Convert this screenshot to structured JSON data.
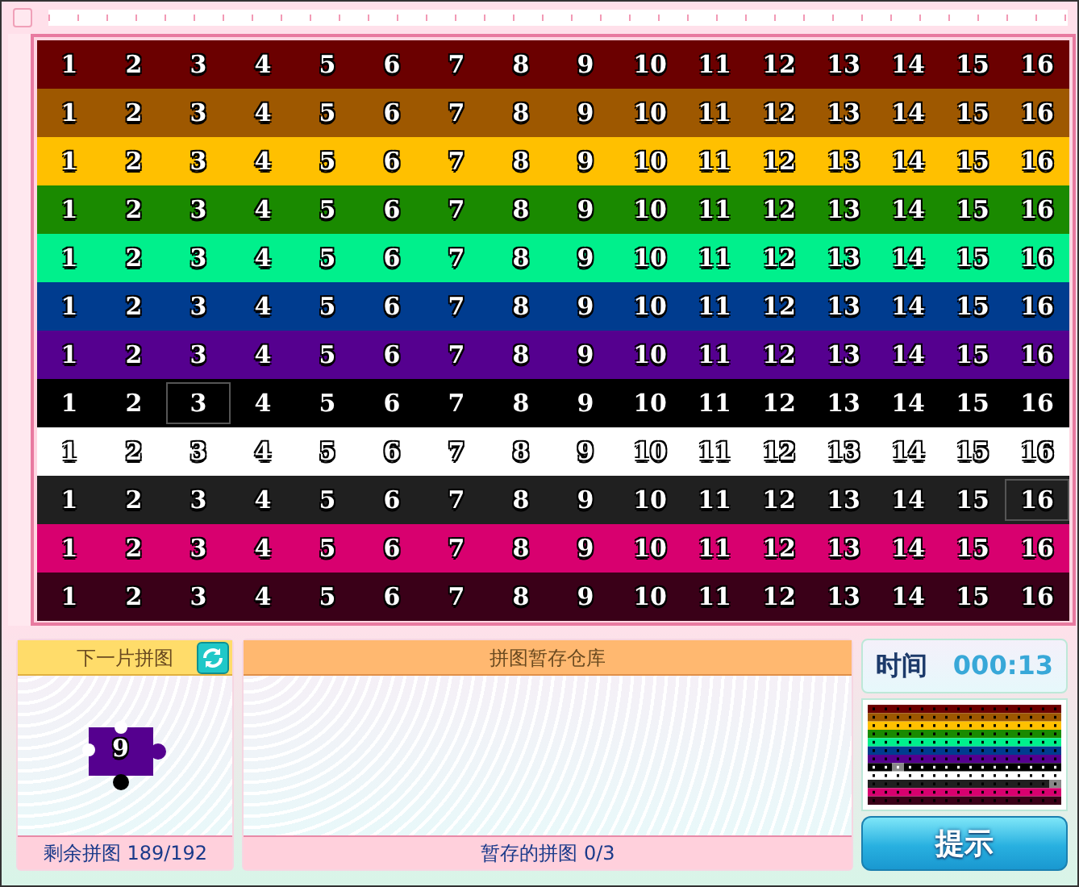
{
  "board": {
    "rows": [
      {
        "color": "#6b0000",
        "outlined": true,
        "cells": [
          {
            "n": "1",
            "placed": true
          },
          {
            "n": "2",
            "placed": true
          },
          {
            "n": "3",
            "placed": true
          },
          {
            "n": "4",
            "placed": true
          },
          {
            "n": "5",
            "placed": true
          },
          {
            "n": "6",
            "placed": true
          },
          {
            "n": "7",
            "placed": true
          },
          {
            "n": "8",
            "placed": true
          },
          {
            "n": "9",
            "placed": true
          },
          {
            "n": "10",
            "placed": true
          },
          {
            "n": "11",
            "placed": true
          },
          {
            "n": "12",
            "placed": true
          },
          {
            "n": "13",
            "placed": true
          },
          {
            "n": "14",
            "placed": true
          },
          {
            "n": "15",
            "placed": true
          },
          {
            "n": "16",
            "placed": true
          }
        ]
      },
      {
        "color": "#9e5800",
        "outlined": true,
        "cells": [
          {
            "n": "1",
            "placed": true
          },
          {
            "n": "2",
            "placed": true
          },
          {
            "n": "3",
            "placed": true
          },
          {
            "n": "4",
            "placed": true
          },
          {
            "n": "5",
            "placed": true
          },
          {
            "n": "6",
            "placed": true
          },
          {
            "n": "7",
            "placed": true
          },
          {
            "n": "8",
            "placed": true
          },
          {
            "n": "9",
            "placed": true
          },
          {
            "n": "10",
            "placed": true
          },
          {
            "n": "11",
            "placed": true
          },
          {
            "n": "12",
            "placed": true
          },
          {
            "n": "13",
            "placed": true
          },
          {
            "n": "14",
            "placed": true
          },
          {
            "n": "15",
            "placed": true
          },
          {
            "n": "16",
            "placed": true
          }
        ]
      },
      {
        "color": "#ffc000",
        "outlined": true,
        "cells": [
          {
            "n": "1",
            "placed": true
          },
          {
            "n": "2",
            "placed": true
          },
          {
            "n": "3",
            "placed": true
          },
          {
            "n": "4",
            "placed": true
          },
          {
            "n": "5",
            "placed": true
          },
          {
            "n": "6",
            "placed": true
          },
          {
            "n": "7",
            "placed": true
          },
          {
            "n": "8",
            "placed": true
          },
          {
            "n": "9",
            "placed": true
          },
          {
            "n": "10",
            "placed": true
          },
          {
            "n": "11",
            "placed": true
          },
          {
            "n": "12",
            "placed": true
          },
          {
            "n": "13",
            "placed": true
          },
          {
            "n": "14",
            "placed": true
          },
          {
            "n": "15",
            "placed": true
          },
          {
            "n": "16",
            "placed": true
          }
        ]
      },
      {
        "color": "#1a8a00",
        "outlined": true,
        "cells": [
          {
            "n": "1",
            "placed": true
          },
          {
            "n": "2",
            "placed": true
          },
          {
            "n": "3",
            "placed": true
          },
          {
            "n": "4",
            "placed": true
          },
          {
            "n": "5",
            "placed": true
          },
          {
            "n": "6",
            "placed": true
          },
          {
            "n": "7",
            "placed": true
          },
          {
            "n": "8",
            "placed": true
          },
          {
            "n": "9",
            "placed": true
          },
          {
            "n": "10",
            "placed": true
          },
          {
            "n": "11",
            "placed": true
          },
          {
            "n": "12",
            "placed": true
          },
          {
            "n": "13",
            "placed": true
          },
          {
            "n": "14",
            "placed": true
          },
          {
            "n": "15",
            "placed": true
          },
          {
            "n": "16",
            "placed": true
          }
        ]
      },
      {
        "color": "#00f08c",
        "outlined": true,
        "cells": [
          {
            "n": "1",
            "placed": true
          },
          {
            "n": "2",
            "placed": true
          },
          {
            "n": "3",
            "placed": true
          },
          {
            "n": "4",
            "placed": true
          },
          {
            "n": "5",
            "placed": true
          },
          {
            "n": "6",
            "placed": true
          },
          {
            "n": "7",
            "placed": true
          },
          {
            "n": "8",
            "placed": true
          },
          {
            "n": "9",
            "placed": true
          },
          {
            "n": "10",
            "placed": true
          },
          {
            "n": "11",
            "placed": true
          },
          {
            "n": "12",
            "placed": true
          },
          {
            "n": "13",
            "placed": true
          },
          {
            "n": "14",
            "placed": true
          },
          {
            "n": "15",
            "placed": true
          },
          {
            "n": "16",
            "placed": true
          }
        ]
      },
      {
        "color": "#003c8f",
        "outlined": true,
        "cells": [
          {
            "n": "1",
            "placed": true
          },
          {
            "n": "2",
            "placed": true
          },
          {
            "n": "3",
            "placed": true
          },
          {
            "n": "4",
            "placed": true
          },
          {
            "n": "5",
            "placed": true
          },
          {
            "n": "6",
            "placed": true
          },
          {
            "n": "7",
            "placed": true
          },
          {
            "n": "8",
            "placed": true
          },
          {
            "n": "9",
            "placed": true
          },
          {
            "n": "10",
            "placed": true
          },
          {
            "n": "11",
            "placed": true
          },
          {
            "n": "12",
            "placed": true
          },
          {
            "n": "13",
            "placed": true
          },
          {
            "n": "14",
            "placed": true
          },
          {
            "n": "15",
            "placed": true
          },
          {
            "n": "16",
            "placed": true
          }
        ]
      },
      {
        "color": "#55008f",
        "outlined": true,
        "cells": [
          {
            "n": "1",
            "placed": true
          },
          {
            "n": "2",
            "placed": true
          },
          {
            "n": "3",
            "placed": true
          },
          {
            "n": "4",
            "placed": true
          },
          {
            "n": "5",
            "placed": true
          },
          {
            "n": "6",
            "placed": true
          },
          {
            "n": "7",
            "placed": true
          },
          {
            "n": "8",
            "placed": true
          },
          {
            "n": "9",
            "placed": true
          },
          {
            "n": "10",
            "placed": true
          },
          {
            "n": "11",
            "placed": true
          },
          {
            "n": "12",
            "placed": true
          },
          {
            "n": "13",
            "placed": true
          },
          {
            "n": "14",
            "placed": true
          },
          {
            "n": "15",
            "placed": true
          },
          {
            "n": "16",
            "placed": true
          }
        ]
      },
      {
        "color": "#000000",
        "outlined": false,
        "cells": [
          {
            "n": "1",
            "placed": true
          },
          {
            "n": "2",
            "placed": true
          },
          {
            "n": "3",
            "placed": false
          },
          {
            "n": "4",
            "placed": true
          },
          {
            "n": "5",
            "placed": true
          },
          {
            "n": "6",
            "placed": true
          },
          {
            "n": "7",
            "placed": true
          },
          {
            "n": "8",
            "placed": true
          },
          {
            "n": "9",
            "placed": true
          },
          {
            "n": "10",
            "placed": true
          },
          {
            "n": "11",
            "placed": true
          },
          {
            "n": "12",
            "placed": true
          },
          {
            "n": "13",
            "placed": true
          },
          {
            "n": "14",
            "placed": true
          },
          {
            "n": "15",
            "placed": true
          },
          {
            "n": "16",
            "placed": true
          }
        ]
      },
      {
        "color": "#ffffff",
        "outlined": true,
        "cells": [
          {
            "n": "1",
            "placed": true
          },
          {
            "n": "2",
            "placed": true
          },
          {
            "n": "3",
            "placed": true
          },
          {
            "n": "4",
            "placed": true
          },
          {
            "n": "5",
            "placed": true
          },
          {
            "n": "6",
            "placed": true
          },
          {
            "n": "7",
            "placed": true
          },
          {
            "n": "8",
            "placed": true
          },
          {
            "n": "9",
            "placed": true
          },
          {
            "n": "10",
            "placed": true
          },
          {
            "n": "11",
            "placed": true
          },
          {
            "n": "12",
            "placed": true
          },
          {
            "n": "13",
            "placed": true
          },
          {
            "n": "14",
            "placed": true
          },
          {
            "n": "15",
            "placed": true
          },
          {
            "n": "16",
            "placed": true
          }
        ]
      },
      {
        "color": "#202020",
        "outlined": true,
        "cells": [
          {
            "n": "1",
            "placed": true
          },
          {
            "n": "2",
            "placed": true
          },
          {
            "n": "3",
            "placed": true
          },
          {
            "n": "4",
            "placed": true
          },
          {
            "n": "5",
            "placed": true
          },
          {
            "n": "6",
            "placed": true
          },
          {
            "n": "7",
            "placed": true
          },
          {
            "n": "8",
            "placed": true
          },
          {
            "n": "9",
            "placed": true
          },
          {
            "n": "10",
            "placed": true
          },
          {
            "n": "11",
            "placed": true
          },
          {
            "n": "12",
            "placed": true
          },
          {
            "n": "13",
            "placed": true
          },
          {
            "n": "14",
            "placed": true
          },
          {
            "n": "15",
            "placed": true
          },
          {
            "n": "16",
            "placed": false
          }
        ]
      },
      {
        "color": "#d8006f",
        "outlined": true,
        "cells": [
          {
            "n": "1",
            "placed": true
          },
          {
            "n": "2",
            "placed": true
          },
          {
            "n": "3",
            "placed": true
          },
          {
            "n": "4",
            "placed": true
          },
          {
            "n": "5",
            "placed": true
          },
          {
            "n": "6",
            "placed": true
          },
          {
            "n": "7",
            "placed": true
          },
          {
            "n": "8",
            "placed": true
          },
          {
            "n": "9",
            "placed": true
          },
          {
            "n": "10",
            "placed": true
          },
          {
            "n": "11",
            "placed": true
          },
          {
            "n": "12",
            "placed": true
          },
          {
            "n": "13",
            "placed": true
          },
          {
            "n": "14",
            "placed": true
          },
          {
            "n": "15",
            "placed": true
          },
          {
            "n": "16",
            "placed": true
          }
        ]
      },
      {
        "color": "#3a0018",
        "outlined": true,
        "cells": [
          {
            "n": "1",
            "placed": true
          },
          {
            "n": "2",
            "placed": true
          },
          {
            "n": "3",
            "placed": true
          },
          {
            "n": "4",
            "placed": true
          },
          {
            "n": "5",
            "placed": true
          },
          {
            "n": "6",
            "placed": true
          },
          {
            "n": "7",
            "placed": true
          },
          {
            "n": "8",
            "placed": true
          },
          {
            "n": "9",
            "placed": true
          },
          {
            "n": "10",
            "placed": true
          },
          {
            "n": "11",
            "placed": true
          },
          {
            "n": "12",
            "placed": true
          },
          {
            "n": "13",
            "placed": true
          },
          {
            "n": "14",
            "placed": true
          },
          {
            "n": "15",
            "placed": true
          },
          {
            "n": "16",
            "placed": true
          }
        ]
      }
    ]
  },
  "next_piece": {
    "title": "下一片拼图",
    "label": "9",
    "color": "#55008f",
    "footer": "剩余拼图 189/192"
  },
  "storage": {
    "title": "拼图暂存仓库",
    "footer": "暂存的拼图 0/3"
  },
  "timer": {
    "label": "时间",
    "value": "000:13"
  },
  "hint_button": "提示"
}
